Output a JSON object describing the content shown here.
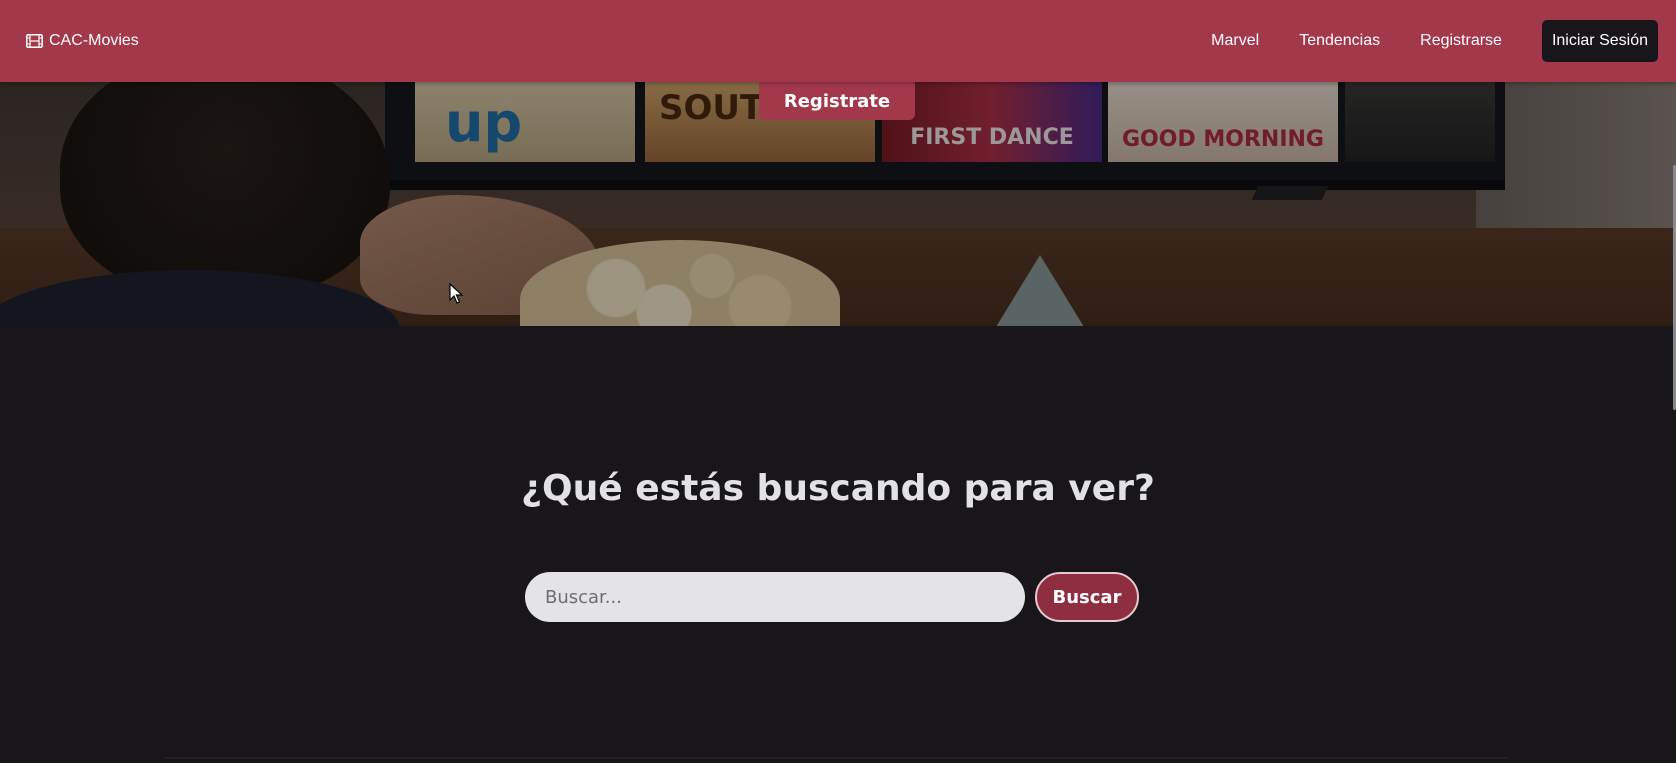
{
  "navbar": {
    "brand_icon": "film-icon",
    "brand": "CAC-Movies",
    "links": [
      "Marvel",
      "Tendencias",
      "Registrarse"
    ],
    "login_button": "Iniciar Sesión"
  },
  "hero": {
    "cta_label": "Registrate",
    "posters": [
      "up",
      "SOUTH",
      "FIRST DANCE",
      "GOOD MORNING"
    ]
  },
  "search": {
    "title": "¿Qué estás buscando para ver?",
    "placeholder": "Buscar...",
    "button_label": "Buscar"
  },
  "colors": {
    "navbar_bg": "#a4384b",
    "page_bg": "#18161b",
    "search_button_bg": "#8f2e40",
    "login_button_bg": "#18161b"
  }
}
